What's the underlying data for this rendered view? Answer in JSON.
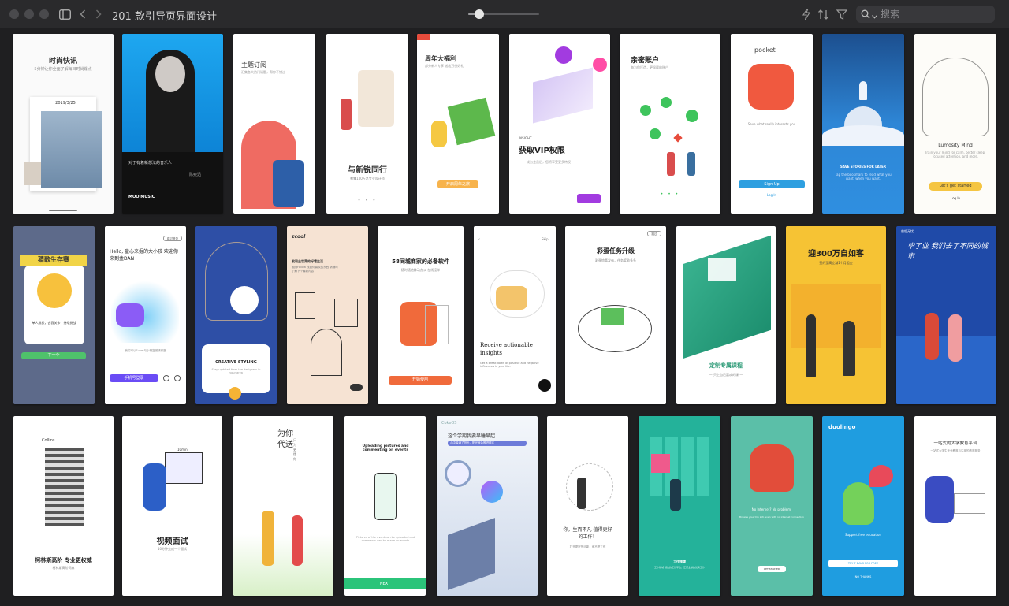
{
  "window": {
    "title": "201 款引导页界面设计",
    "zoom_fraction": 0.15,
    "search_placeholder": "搜索"
  },
  "icons": [
    "sidebar-toggle-icon",
    "back-icon",
    "forward-icon",
    "bolt-icon",
    "sort-icon",
    "filter-icon",
    "search-icon",
    "chevron-down-icon"
  ],
  "screens": {
    "r1": [
      {
        "title": "时尚快讯",
        "sub": "5分钟让你全面了解每日时尚爆点",
        "extra": "2019/3/25"
      },
      {
        "brand": "MOO MUSIC",
        "quote": "对于有着新想法的音乐人",
        "sign": "陈奕迅"
      },
      {
        "title": "主题订阅",
        "sub": "汇集各大热门话题，帮你不错过"
      },
      {
        "title": "与新锐同行",
        "sub": "聚集100万名专业设计师"
      },
      {
        "title": "周年大福利",
        "sub": "部分新人专享 送出万份好礼",
        "button": "开启周年之旅"
      },
      {
        "title": "获取VIP权限",
        "kicker": "INSIGHT",
        "sub": "成为会员后，您将享受更多特权"
      },
      {
        "title": "亲密账户",
        "sub": "每为你打造，更温暖的账户"
      },
      {
        "brand": "pocket",
        "sub": "Save what really interests you",
        "button": "Sign Up",
        "link": "Log In"
      },
      {
        "title": "SAVE STORIES FOR LATER",
        "sub": "Tap the bookmark to read what you want, when you want."
      },
      {
        "title": "Lumosity Mind",
        "sub": "Train your mind for calm, better sleep, focused attention, and more.",
        "button": "Let's get started",
        "link": "Log In"
      }
    ],
    "r2": [
      {
        "title": "猜歌生存赛",
        "sub": "单人成长，去我关卡，持续挑战",
        "button": "下一个"
      },
      {
        "title": "Hello, 童心来掘的大小孩 欢迎你来到盒DAN",
        "sub": "我们可以Super与小精复邀请家庭",
        "button": "手机号登录",
        "skip": "跳过登录"
      },
      {
        "title": "CREATIVE STYLING",
        "sub": "Stay updated from the designers in your area"
      },
      {
        "brand": "zcool",
        "title": "发现全世界的好看生活",
        "sub": "跟随Follow 找到你喜欢的东西 请随时了解下个最新内容"
      },
      {
        "title": "58同城商家的必备软件",
        "sub": "随时随地移动办公 在线接单",
        "button": "开始使用"
      },
      {
        "title": "Receive actionable insights",
        "sub": "Get a break down of positive and negative influences in your life.",
        "skip": "Skip"
      },
      {
        "title": "彩蛋任务升级",
        "sub": "彩蛋惊喜发布，任务奖励多多",
        "skip": "跳过"
      },
      {
        "title": "定制专属课程",
        "sub": "— 只上自己喜欢的课 —"
      },
      {
        "title": "迎300万自如客",
        "sub": "签约至高立减1个月租金"
      },
      {
        "title": "毕了业 我们去了不同的城市",
        "brand": "前程无忧"
      }
    ],
    "r3": [
      {
        "brand": "Collins",
        "title": "柯林斯高阶 专业更权威",
        "sub": "柯林斯高阶词典"
      },
      {
        "title": "视频面试",
        "sub": "10分钟完成一个面试",
        "extra": "10min"
      },
      {
        "title": "为你代送",
        "sub": "只为更懂你"
      },
      {
        "title": "Uploading pictures and commenting on events",
        "sub": "Pictures of the event can be uploaded and comments can be made on events",
        "button": "NEXT"
      },
      {
        "brand": "CokeOS",
        "title": "这个学期我要早睡早起",
        "sub": "心中装满了阳光，阳光就会照进现实"
      },
      {
        "title": "你，生而不凡 值得更好的工作！",
        "sub": "打开更好的可能，而不是工作"
      },
      {
        "title": "工作领域",
        "sub": "工作领域 领先的工作平台，汇聚全球的优秀工作"
      },
      {
        "title": "No Internet? No problem.",
        "sub": "Browse your trip info even with no internet connection",
        "button": "GET STARTED"
      },
      {
        "brand": "duolingo",
        "title": "Support free education",
        "button": "TRY 7 DAYS FOR FREE",
        "link": "NO THANKS"
      },
      {
        "title": "一站式的大学教育平台",
        "sub": "一站式大学生专业教育与实用的教育服务"
      }
    ]
  }
}
